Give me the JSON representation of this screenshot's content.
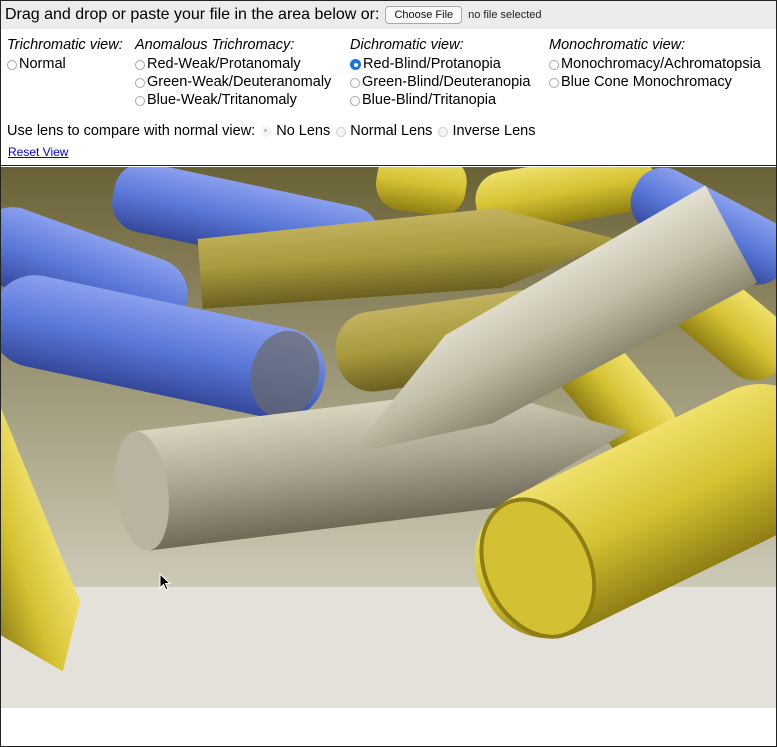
{
  "header": {
    "instruction": "Drag and drop or paste your file in the area below or:",
    "choose_file_label": "Choose File",
    "file_status": "no file selected"
  },
  "groups": {
    "trichromatic": {
      "title": "Trichromatic view:",
      "options": [
        "Normal"
      ]
    },
    "anomalous": {
      "title": "Anomalous Trichromacy:",
      "options": [
        "Red-Weak/Protanomaly",
        "Green-Weak/Deuteranomaly",
        "Blue-Weak/Tritanomaly"
      ]
    },
    "dichromatic": {
      "title": "Dichromatic view:",
      "options": [
        "Red-Blind/Protanopia",
        "Green-Blind/Deuteranopia",
        "Blue-Blind/Tritanopia"
      ]
    },
    "monochromatic": {
      "title": "Monochromatic view:",
      "options": [
        "Monochromacy/Achromatopsia",
        "Blue Cone Monochromacy"
      ]
    }
  },
  "selected_view": "Red-Blind/Protanopia",
  "lens": {
    "label": "Use lens to compare with normal view:",
    "options": [
      "No Lens",
      "Normal Lens",
      "Inverse Lens"
    ],
    "selected": "No Lens"
  },
  "reset_label": "Reset View",
  "colors": {
    "radio_selected": "#1a73e8",
    "link": "#0000ee",
    "topbar_bg": "#ececec",
    "crayon_yellow": "#d8c63a",
    "crayon_blue": "#5a78d8",
    "crayon_gray": "#a8a38c"
  },
  "image": {
    "subject": "crayons"
  }
}
